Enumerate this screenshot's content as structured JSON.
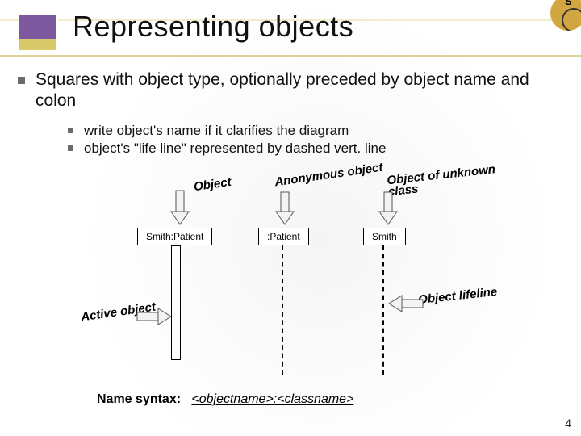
{
  "slide": {
    "title": "Representing objects",
    "corner_badge_letter": "S",
    "bullet": "Squares with object type, optionally preceded by object name and colon",
    "sub_bullets": [
      "write object's name if it clarifies the diagram",
      "object's \"life line\" represented by dashed vert. line"
    ],
    "page_number": "4"
  },
  "diagram": {
    "labels": {
      "object": "Object",
      "anonymous_object": "Anonymous object",
      "unknown_class": "Object of unknown class",
      "active_object": "Active object",
      "object_lifeline": "Object lifeline"
    },
    "boxes": {
      "named": "Smith:Patient",
      "anonymous": ":Patient",
      "unknown": "Smith"
    },
    "syntax_label": "Name syntax:",
    "syntax_value": "<objectname>:<classname>"
  }
}
